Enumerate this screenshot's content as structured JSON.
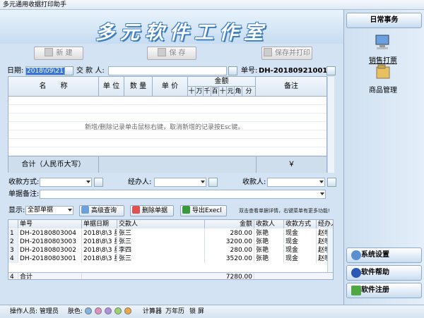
{
  "window": {
    "title": "多元通用收据打印助手"
  },
  "banner": {
    "title": "多元软件工作室"
  },
  "toolbar": {
    "new_label": "新 建",
    "save_label": "保 存",
    "save_print_label": "保存并打印"
  },
  "form": {
    "date_label": "日期:",
    "date_value": "2018\\09\\21",
    "payer_label": "交 款 人:",
    "payer_value": "",
    "doc_no_label": "单号:",
    "doc_no_value": "DH-20180921001",
    "method_label": "收款方式:",
    "handler_label": "经办人:",
    "receiver_label": "收款人:",
    "remark_label": "单据备注:"
  },
  "items_grid": {
    "headers": {
      "name": "名　　称",
      "unit": "单 位",
      "qty": "数 量",
      "price": "单 价",
      "amount": "金额",
      "remark": "备注"
    },
    "digits": [
      "十",
      "万",
      "千",
      "百",
      "十",
      "元",
      "角",
      "分"
    ],
    "hint": "新增/删除记录单击鼠标右键，取消新增的记录按Esc键。",
    "total_label": "合计（人民币大写）",
    "total_symbol": "￥"
  },
  "list_toolbar": {
    "show_label": "显示:",
    "filter_value": "全部单据",
    "advanced_query": "高级查询",
    "delete_doc": "删除单据",
    "export_excel": "导出Execl",
    "tip": "双击查看单据详情，右键菜单有更多功能!"
  },
  "doc_list": {
    "columns": [
      "单号",
      "单据日期",
      "交款人",
      "金额",
      "收款人",
      "收款方式",
      "经办人"
    ],
    "rows": [
      {
        "idx": "1",
        "no": "DH-20180803004",
        "date": "2018\\8\\3 星",
        "payer": "张三",
        "amount": "280.00",
        "receiver": "张艳",
        "method": "现金",
        "handler": "赵明"
      },
      {
        "idx": "2",
        "no": "DH-20180803003",
        "date": "2018\\8\\3 星",
        "payer": "张三",
        "amount": "3200.00",
        "receiver": "张艳",
        "method": "现金",
        "handler": "赵明"
      },
      {
        "idx": "3",
        "no": "DH-20180803002",
        "date": "2018\\8\\3 星",
        "payer": "李四",
        "amount": "280.00",
        "receiver": "张艳",
        "method": "现金",
        "handler": "赵明"
      },
      {
        "idx": "4",
        "no": "DH-20180803001",
        "date": "2018\\8\\3 星",
        "payer": "张三",
        "amount": "3520.00",
        "receiver": "张艳",
        "method": "现金",
        "handler": "赵明"
      }
    ],
    "footer": {
      "count": "4",
      "label": "合计",
      "amount": "7280.00"
    }
  },
  "status_bar": {
    "operator": "操作人员: 管理员",
    "skin_label": "肤色:",
    "skin_colors": [
      "#7fb2e5",
      "#e58fc0",
      "#b08fe0",
      "#9bd36f",
      "#f0a640"
    ],
    "calculator": "计算器",
    "calendar": "万年历",
    "lock": "锁 屏"
  },
  "sidebar": {
    "header": "日常事务",
    "items": [
      {
        "label": "销售打票"
      },
      {
        "label": "商品管理"
      }
    ],
    "bottom_buttons": [
      {
        "label": "系统设置"
      },
      {
        "label": "软件帮助"
      },
      {
        "label": "软件注册"
      }
    ]
  }
}
